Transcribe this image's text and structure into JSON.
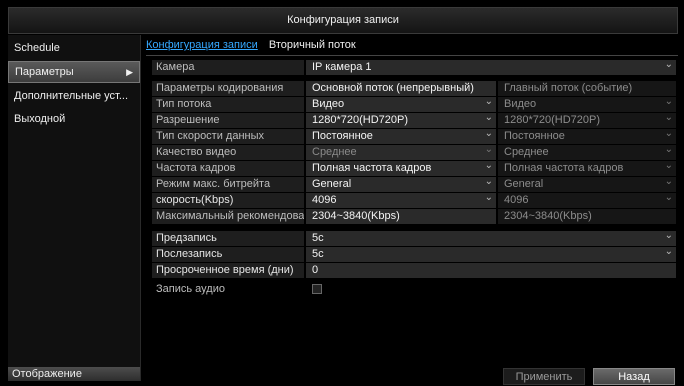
{
  "window": {
    "title": "Конфигурация записи"
  },
  "sidebar": {
    "items": [
      {
        "label": "Schedule"
      },
      {
        "label": "Параметры"
      },
      {
        "label": "Дополнительные уст..."
      },
      {
        "label": "Выходной"
      }
    ],
    "bottom_label": "Отображение"
  },
  "tabs": [
    {
      "label": "Конфигурация записи"
    },
    {
      "label": "Вторичный поток"
    }
  ],
  "form": {
    "camera": {
      "label": "Камера",
      "value": "IP камера 1"
    },
    "encoding": {
      "label": "Параметры кодирования",
      "main": "Основной поток (непрерывный)",
      "secondary": "Главный поток (событие)"
    },
    "stream_type": {
      "label": "Тип потока",
      "main": "Видео",
      "secondary": "Видео"
    },
    "resolution": {
      "label": "Разрешение",
      "main": "1280*720(HD720P)",
      "secondary": "1280*720(HD720P)"
    },
    "bitrate_type": {
      "label": "Тип скорости данных",
      "main": "Постоянное",
      "secondary": "Постоянное"
    },
    "video_quality": {
      "label": "Качество видео",
      "main": "Среднее",
      "secondary": "Среднее"
    },
    "frame_rate": {
      "label": "Частота кадров",
      "main": "Полная частота кадров",
      "secondary": "Полная частота кадров"
    },
    "max_bitrate_mode": {
      "label": "Режим макс. битрейта",
      "main": "General",
      "secondary": "General"
    },
    "bitrate": {
      "label": "скорость(Kbps)",
      "main": "4096",
      "secondary": "4096"
    },
    "recommended": {
      "label": "Максимальный рекомендован...",
      "main": "2304~3840(Kbps)",
      "secondary": "2304~3840(Kbps)"
    },
    "pre_record": {
      "label": "Предзапись",
      "value": "5с"
    },
    "post_record": {
      "label": "Послезапись",
      "value": "5с"
    },
    "expired_time": {
      "label": "Просроченное время (дни)",
      "value": "0"
    },
    "audio": {
      "label": "Запись аудио",
      "checked": false
    }
  },
  "buttons": {
    "apply": "Применить",
    "back": "Назад"
  }
}
